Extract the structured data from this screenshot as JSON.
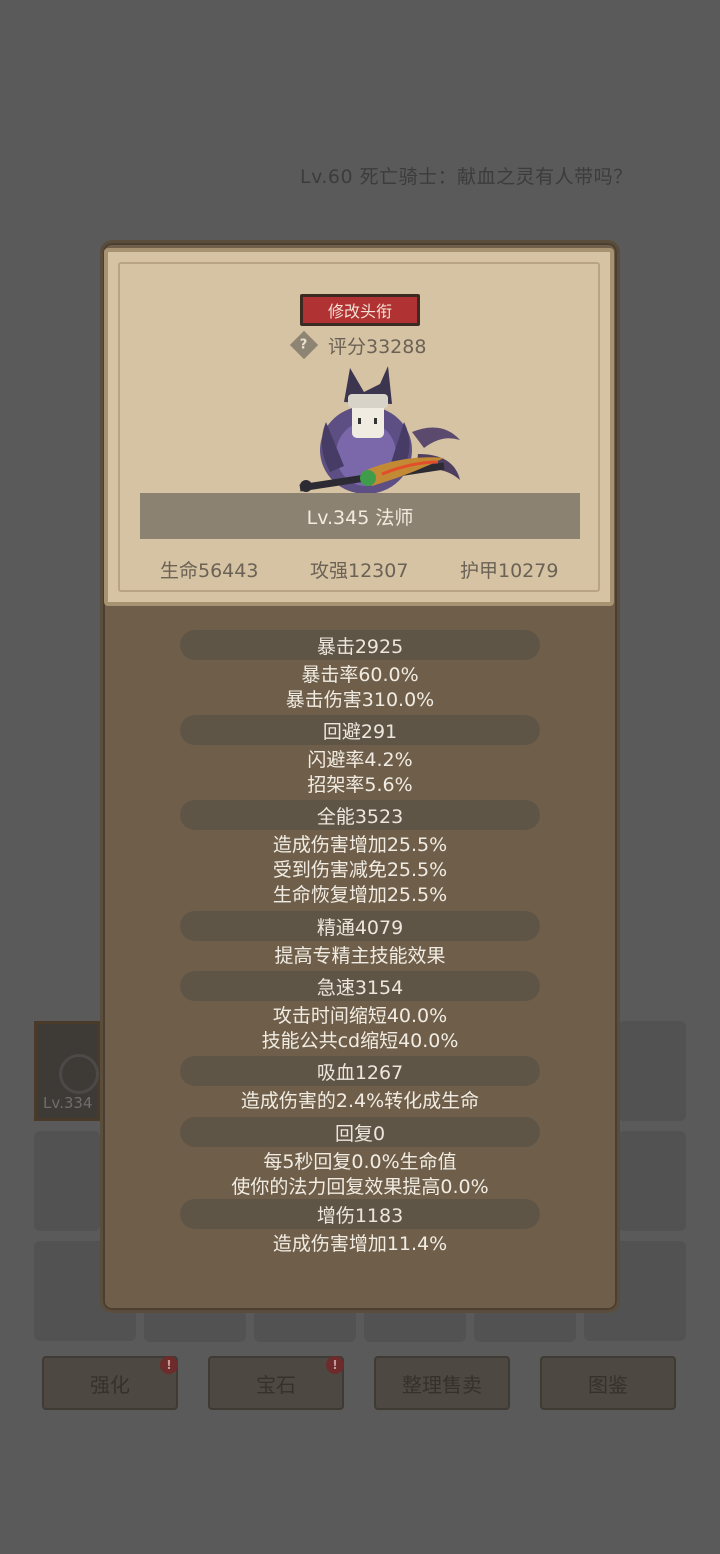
{
  "background": {
    "title": "Lv.60 死亡骑士：献血之灵有人带吗？",
    "inventory_item_level": "Lv.334",
    "buttons": [
      "强化",
      "宝石",
      "整理售卖",
      "图鉴"
    ],
    "alert_mark": "!"
  },
  "character": {
    "rename_label": "修改头衔",
    "help_mark": "?",
    "score": "评分33288",
    "name_line": "Lv.345 法师",
    "hp": "生命56443",
    "attack": "攻强12307",
    "armor": "护甲10279"
  },
  "attributes": [
    {
      "title": "暴击2925",
      "lines": [
        "暴击率60.0%",
        "暴击伤害310.0%"
      ]
    },
    {
      "title": "回避291",
      "lines": [
        "闪避率4.2%",
        "招架率5.6%"
      ]
    },
    {
      "title": "全能3523",
      "lines": [
        "造成伤害增加25.5%",
        "受到伤害减免25.5%",
        "生命恢复增加25.5%"
      ]
    },
    {
      "title": "精通4079",
      "lines": [
        "提高专精主技能效果"
      ]
    },
    {
      "title": "急速3154",
      "lines": [
        "攻击时间缩短40.0%",
        "技能公共cd缩短40.0%"
      ]
    },
    {
      "title": "吸血1267",
      "lines": [
        "造成伤害的2.4%转化成生命"
      ]
    },
    {
      "title": "回复0",
      "lines": [
        "每5秒回复0.0%生命值",
        "使你的法力回复效果提高0.0%"
      ]
    },
    {
      "title": "增伤1183",
      "lines": [
        "造成伤害增加11.4%"
      ]
    }
  ]
}
